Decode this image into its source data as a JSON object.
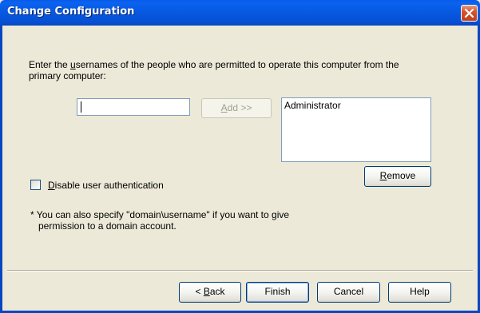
{
  "window": {
    "title": "Change Configuration"
  },
  "instruction": {
    "prefix": "Enter the ",
    "underlined": "u",
    "rest": "sernames of the people who are permitted to operate this computer from the",
    "line2": "primary computer:"
  },
  "username_input": {
    "value": ""
  },
  "add_button": {
    "underlined": "A",
    "rest": "dd >>"
  },
  "user_list": {
    "items": [
      "Administrator"
    ]
  },
  "remove_button": {
    "underlined": "R",
    "rest": "emove"
  },
  "disable_auth": {
    "checked": false,
    "underlined": "D",
    "rest": "isable user authentication"
  },
  "note": {
    "line1": "* You can also specify \"domain\\username\" if you want to give",
    "line2": "permission to a domain account."
  },
  "footer": {
    "back_prefix": "< ",
    "back_underlined": "B",
    "back_rest": "ack",
    "finish_label": "Finish",
    "cancel_label": "Cancel",
    "help_label": "Help"
  },
  "colors": {
    "titlebar": "#0a5ae8",
    "close_button": "#d5532d",
    "dialog_background": "#ece9d8"
  }
}
